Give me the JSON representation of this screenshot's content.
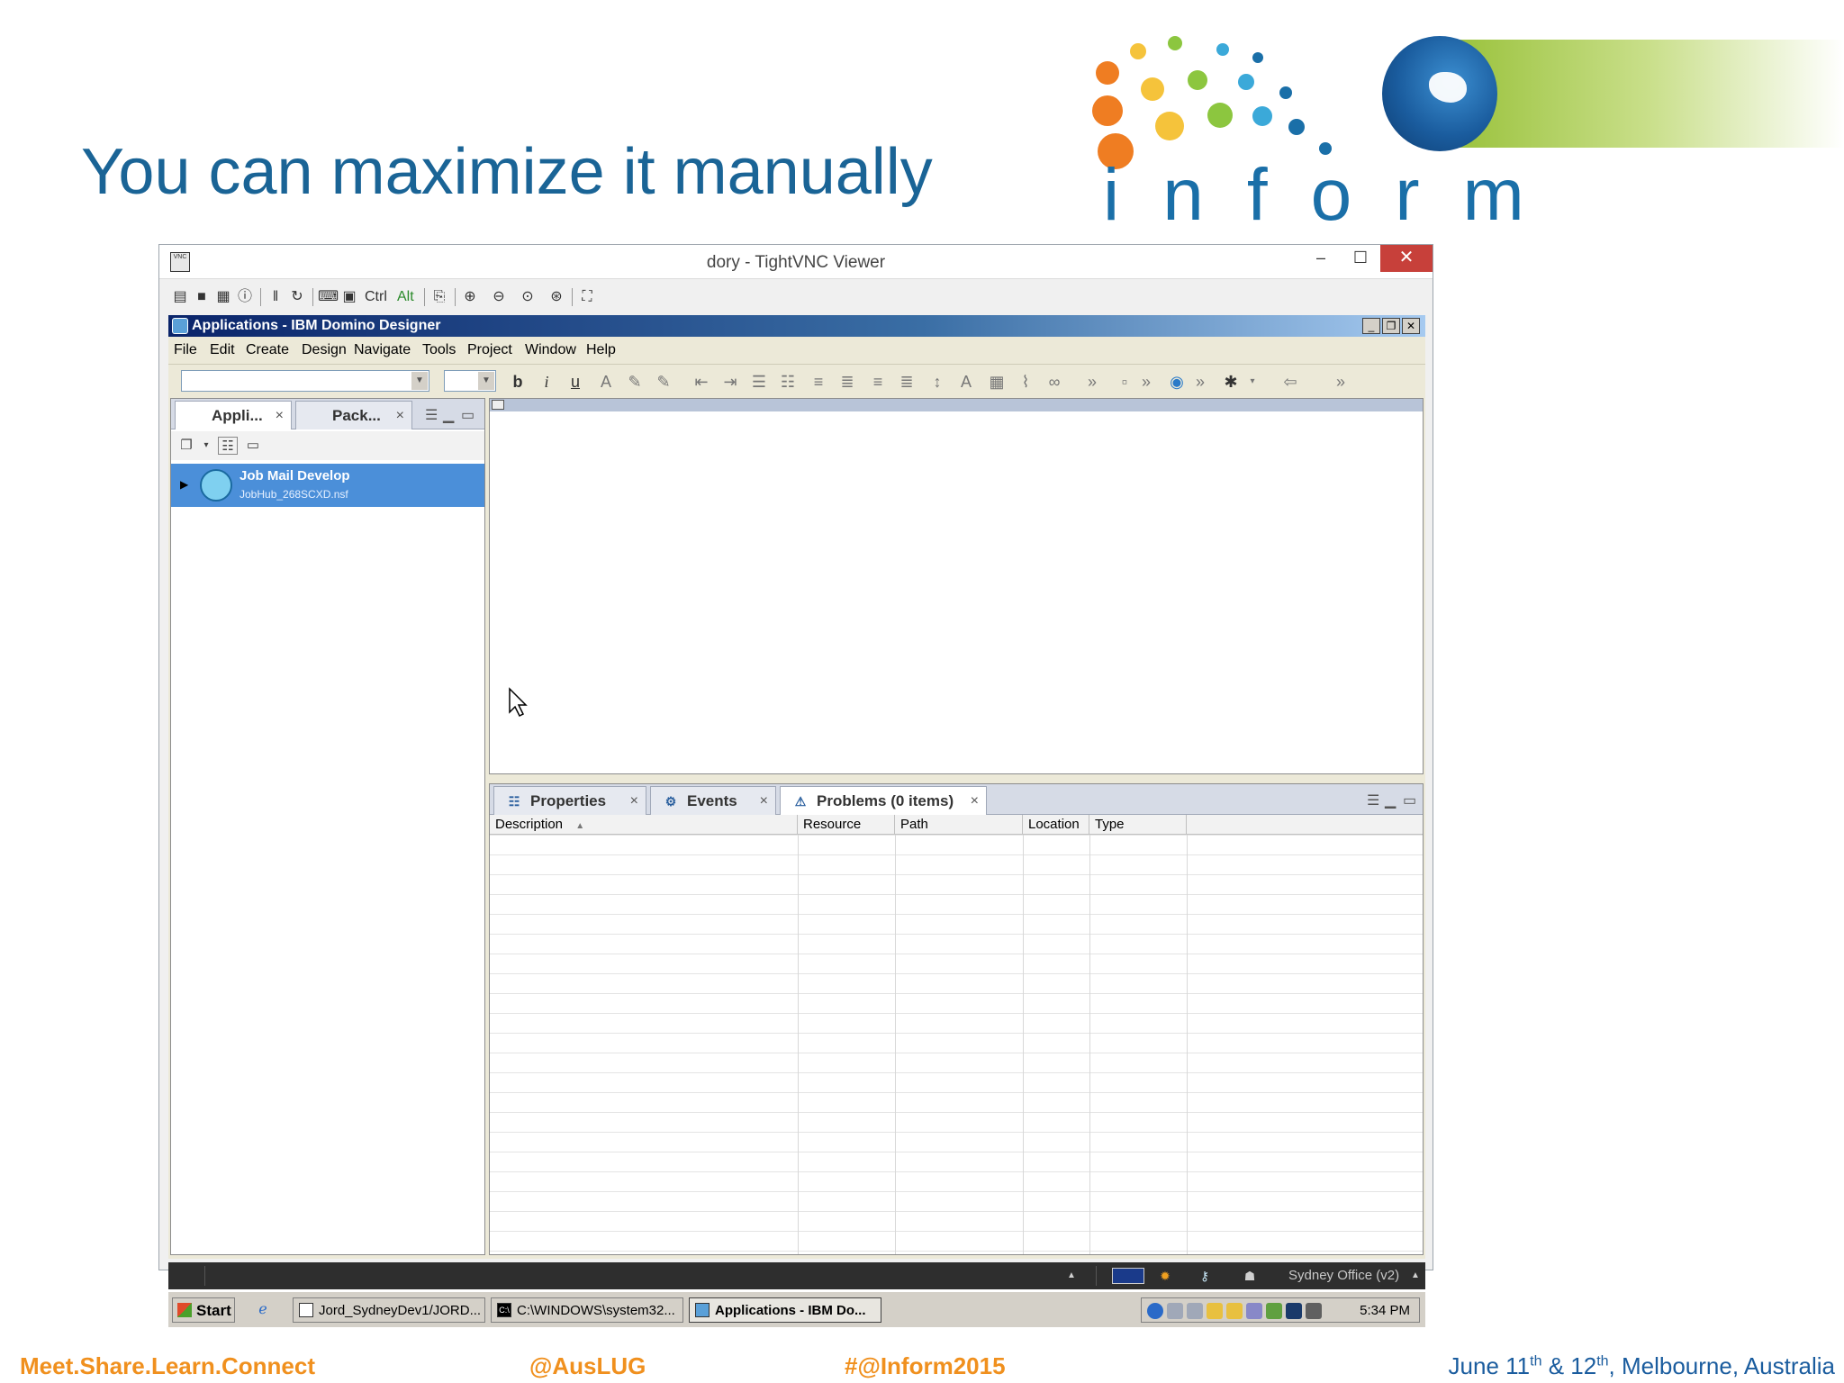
{
  "slide": {
    "title": "You can maximize it manually"
  },
  "logo": {
    "text": "inform",
    "colors": [
      "#ef7d22",
      "#f5c33b",
      "#8cc63f",
      "#3ba9d9",
      "#1a6fa8"
    ]
  },
  "vnc": {
    "title": "dory - TightVNC Viewer",
    "min_label": "‒",
    "max_label": "☐",
    "close_label": "✕",
    "toolbar": {
      "ctrl_label": "Ctrl",
      "alt_label": "Alt"
    }
  },
  "designer": {
    "title": "Applications - IBM Domino Designer",
    "menu": [
      "File",
      "Edit",
      "Create",
      "Design",
      "Navigate",
      "Tools",
      "Project",
      "Window",
      "Help"
    ],
    "left_tabs": [
      {
        "label": "Appli...",
        "close": "×"
      },
      {
        "label": "Pack...",
        "close": "×"
      }
    ],
    "tree_item": {
      "name": "Job Mail Develop",
      "file": "JobHub_268SCXD.nsf"
    },
    "bottom_tabs": [
      {
        "label": "Properties",
        "close": "×"
      },
      {
        "label": "Events",
        "close": "×"
      },
      {
        "label": "Problems (0 items)",
        "close": "×"
      }
    ],
    "columns": [
      "Description",
      "Resource",
      "Path",
      "Location",
      "Type"
    ],
    "sort_indicator": "▲"
  },
  "status": {
    "location": "Sydney Office (v2)"
  },
  "taskbar": {
    "start": "Start",
    "tasks": [
      "Jord_SydneyDev1/JORD...",
      "C:\\WINDOWS\\system32...",
      "Applications - IBM Do..."
    ],
    "clock": "5:34 PM"
  },
  "footer": {
    "tagline": "Meet.Share.Learn.Connect",
    "handle": "@AusLUG",
    "hashtag": "#@Inform2015",
    "date_prefix": "June 11",
    "date_sup1": "th",
    "date_mid": " & 12",
    "date_sup2": "th",
    "date_suffix": ", Melbourne, Australia"
  }
}
